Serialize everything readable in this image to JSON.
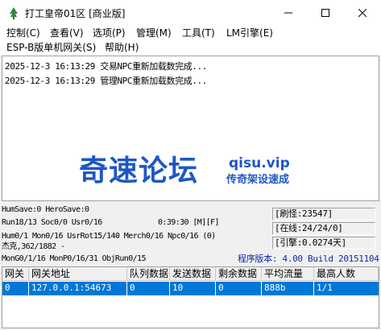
{
  "window": {
    "title": "打工皇帝01区 [商业版]",
    "icon": "tree-app-icon"
  },
  "menu": {
    "items": [
      {
        "label": "控制(C)"
      },
      {
        "label": "查看(V)"
      },
      {
        "label": "选项(P)"
      },
      {
        "label": "管理(M)"
      },
      {
        "label": "工具(T)"
      },
      {
        "label": "LM引擎(E)"
      },
      {
        "label": "ESP-B版单机网关(S)"
      },
      {
        "label": "帮助(H)"
      }
    ]
  },
  "log": {
    "lines": [
      "2025-12-3 16:13:29 交易NPC重新加载数完成...",
      "2025-12-3 16:13:29 管理NPC重新加载数完成..."
    ]
  },
  "watermark": {
    "main": "奇速论坛",
    "url": "qisu.vip",
    "sub": "传奇架设速成"
  },
  "status": {
    "line1": "HumSave:0 HeroSave:0",
    "line2a": "Run18/13 Soc0/0 Usr0/16",
    "line2b": "0:39:30 [M][F]",
    "line3": "Hum0/1 Mon0/16 UsrRot15/140 Merch0/16 Npc0/16 (0)",
    "line4": "杰克,362/1882 -",
    "line5": "MonG0/1/16 MonP0/16/31 ObjRun0/15",
    "box_count": "[刷怪:23547]",
    "box_online": "[在线:24/24/0]",
    "box_engine": "[引擎:0.0274天]",
    "version": "程序版本: 4.00 Build 20151104"
  },
  "table": {
    "headers": [
      "网关",
      "网关地址",
      "队列数据",
      "发送数据",
      "剩余数据",
      "平均流量",
      "最高人数"
    ],
    "rows": [
      [
        "0",
        "127.0.0.1:54673",
        "0",
        "10",
        "0",
        "888b",
        "1/1"
      ]
    ]
  },
  "colors": {
    "selection": "#0078d7",
    "version_text": "#0d2ba8",
    "watermark": "#1e57c4"
  }
}
